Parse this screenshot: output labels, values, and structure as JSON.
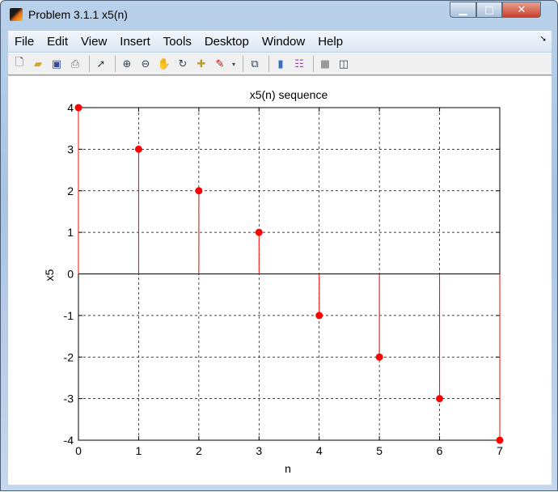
{
  "window": {
    "title": "Problem 3.1.1 x5(n)"
  },
  "menu": [
    "File",
    "Edit",
    "View",
    "Insert",
    "Tools",
    "Desktop",
    "Window",
    "Help"
  ],
  "toolbar": [
    "new-figure",
    "open-file",
    "save",
    "print",
    "edit-plot",
    "zoom-in",
    "zoom-out",
    "pan",
    "rotate-3d",
    "data-cursor",
    "brush",
    "link-plot",
    "insert-colorbar",
    "insert-legend",
    "hide-plot-tools",
    "show-plot-tools"
  ],
  "colors": {
    "stem": "#ff0000",
    "axes": "#000000",
    "grid": "#000000"
  },
  "chart_data": {
    "type": "stem",
    "title": "x5(n) sequence",
    "xlabel": "n",
    "ylabel": "x5",
    "x": [
      0,
      1,
      2,
      3,
      4,
      5,
      6,
      7
    ],
    "values": [
      4,
      3,
      2,
      1,
      -1,
      -2,
      -3,
      -4
    ],
    "xlim": [
      0,
      7
    ],
    "ylim": [
      -4,
      4
    ],
    "xticks": [
      "0",
      "1",
      "2",
      "3",
      "4",
      "5",
      "6",
      "7"
    ],
    "yticks": [
      "4",
      "3",
      "2",
      "1",
      "0",
      "-1",
      "-2",
      "-3",
      "-4"
    ],
    "grid": true
  }
}
